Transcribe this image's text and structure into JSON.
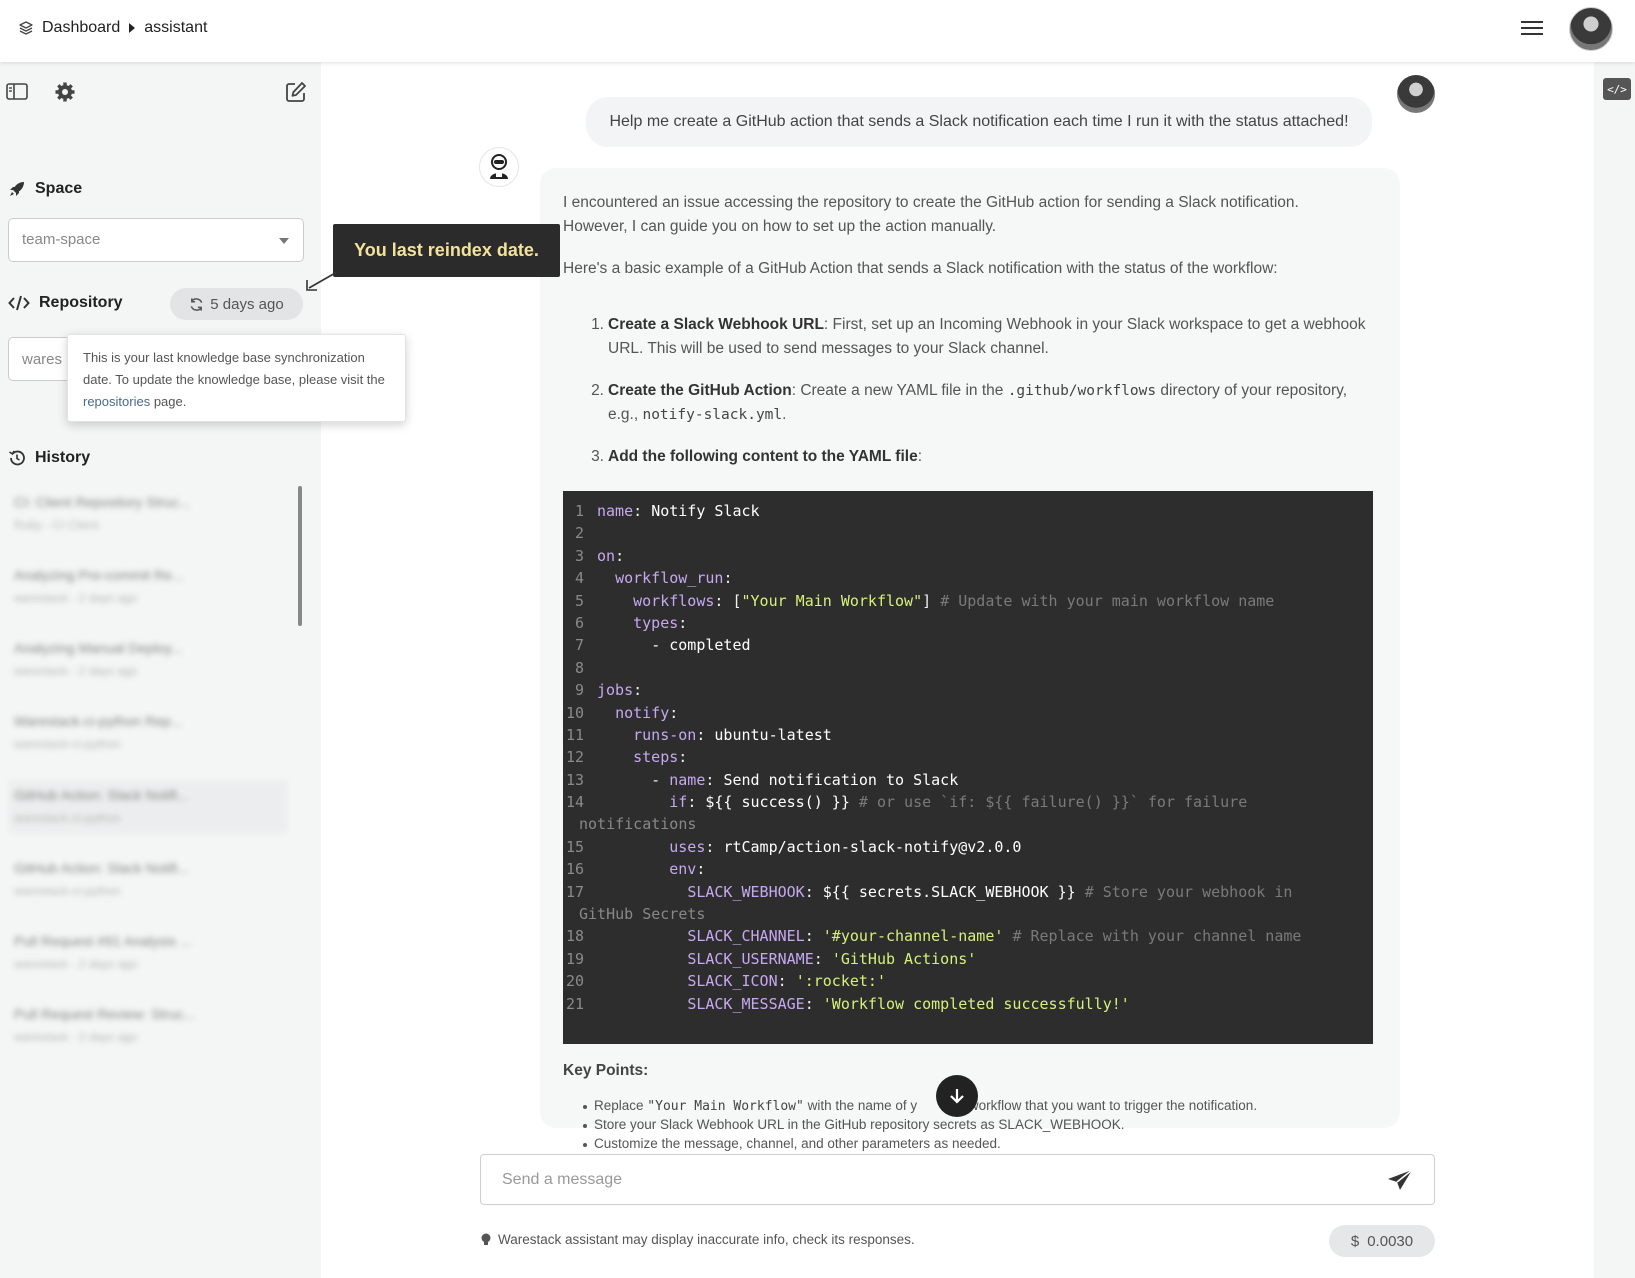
{
  "topbar": {
    "breadcrumb": [
      "Dashboard",
      "assistant"
    ],
    "icons": [
      "layers-icon",
      "hamburger-icon",
      "user-avatar"
    ]
  },
  "sidebar": {
    "space": {
      "title": "Space",
      "value": "team-space"
    },
    "repository": {
      "title": "Repository",
      "last_sync": "5 days ago",
      "value": "wares"
    },
    "history": {
      "title": "History",
      "items": [
        {
          "title": "CI: Client Repository Struc...",
          "subtitle": "Ruby - CI Client"
        },
        {
          "title": "Analyzing Pre-commit Re...",
          "subtitle": "warestack - 2 days ago"
        },
        {
          "title": "Analyzing Manual Deploy...",
          "subtitle": "warestack - 2 days ago"
        },
        {
          "title": "Warestack-ci-python Rep...",
          "subtitle": "warestack-ci-python"
        },
        {
          "title": "GitHub Action: Slack Notifi...",
          "subtitle": "warestack-ci-python"
        },
        {
          "title": "GitHub Action: Slack Notifi...",
          "subtitle": "warestack-ci-python"
        },
        {
          "title": "Pull Request #91 Analysis ...",
          "subtitle": "warestack - 2 days ago"
        },
        {
          "title": "Pull Request Review: Struc...",
          "subtitle": "warestack - 2 days ago"
        }
      ]
    }
  },
  "tooltips": {
    "reindex": "You last reindex date.",
    "sync_before": "This is your last knowledge base synchronization date. To update the knowledge base, please visit the ",
    "sync_link": "repositories",
    "sync_after": " page."
  },
  "chat": {
    "user_message": "Help me create a GitHub action that sends a Slack notification each time I run it with the status attached!",
    "bot_intro_1": "I encountered an issue accessing the repository to create the GitHub action for sending a Slack notification. However, I can guide you on how to set up the action manually.",
    "bot_intro_2": "Here's a basic example of a GitHub Action that sends a Slack notification with the status of the workflow:",
    "steps": [
      {
        "num": "1.",
        "bold": "Create a Slack Webhook URL",
        "text": ": First, set up an Incoming Webhook in your Slack workspace to get a webhook URL. This will be used to send messages to your Slack channel."
      },
      {
        "num": "2.",
        "bold": "Create the GitHub Action",
        "text_a": ": Create a new YAML file in the ",
        "code_a": ".github/workflows",
        "text_b": " directory of your repository, e.g., ",
        "code_b": "notify-slack.yml",
        "text_c": "."
      },
      {
        "num": "3.",
        "bold": "Add the following content to the YAML file",
        "text": ":"
      }
    ],
    "code_lines": [
      "1",
      "2",
      "3",
      "4",
      "5",
      "6",
      "7",
      "8",
      "9",
      "10",
      "11",
      "12",
      "13",
      "14",
      "15",
      "16",
      "17",
      "18",
      "19",
      "20",
      "21"
    ],
    "code": {
      "l1_key": "name",
      "l1_val": "Notify Slack",
      "l3_key": "on",
      "l4_key": "workflow_run",
      "l5_key": "workflows",
      "l5_val": "\"Your Main Workflow\"",
      "l5_comment": "# Update with your main workflow name",
      "l6_key": "types",
      "l7_val": "- completed",
      "l9_key": "jobs",
      "l10_key": "notify",
      "l11_key": "runs-on",
      "l11_val": "ubuntu-latest",
      "l12_key": "steps",
      "l13_key": "name",
      "l13_val": "Send notification to Slack",
      "l14_key": "if",
      "l14_val": "${{ success() }}",
      "l14_comment": "# or use `if: ${{ failure() }}` for failure",
      "l14_wrap": "notifications",
      "l15_key": "uses",
      "l15_val": "rtCamp/action-slack-notify@v2.0.0",
      "l16_key": "env",
      "l17_key": "SLACK_WEBHOOK",
      "l17_val": "${{ secrets.SLACK_WEBHOOK }}",
      "l17_comment": "# Store your webhook in",
      "l17_wrap": "GitHub Secrets",
      "l18_key": "SLACK_CHANNEL",
      "l18_val": "'#your-channel-name'",
      "l18_comment": "# Replace with your channel name",
      "l19_key": "SLACK_USERNAME",
      "l19_val": "'GitHub Actions'",
      "l20_key": "SLACK_ICON",
      "l20_val": "':rocket:'",
      "l21_key": "SLACK_MESSAGE",
      "l21_val": "'Workflow completed successfully!'"
    },
    "key_points_title": "Key Points:",
    "key_points": {
      "p1_a": "Replace ",
      "p1_code": "\"Your Main Workflow\"",
      "p1_b": " with the name of y",
      "p1_c": "ain workflow that you want to trigger the notification.",
      "p2": "Store your Slack Webhook URL in the GitHub repository secrets as SLACK_WEBHOOK.",
      "p3": "Customize the message, channel, and other parameters as needed."
    }
  },
  "composer": {
    "placeholder": "Send a message",
    "disclaimer": "Warestack assistant may display inaccurate info, check its responses.",
    "cost": "0.0030",
    "currency": "$"
  },
  "colors": {
    "code_bg": "#2d2d2d",
    "code_key": "#c6a8f0",
    "code_string": "#d7f07a",
    "tooltip_text": "#f4e29b"
  }
}
